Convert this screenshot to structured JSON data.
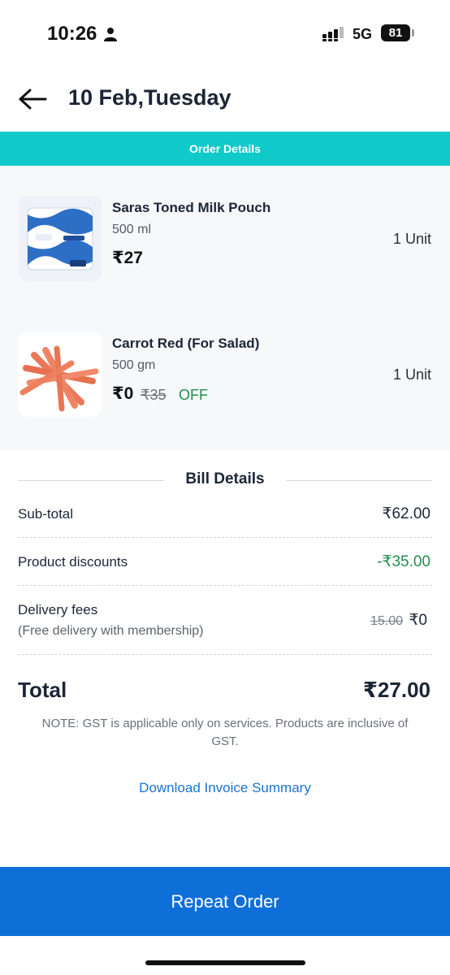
{
  "status_bar": {
    "time": "10:26",
    "network": "5G",
    "battery": "81"
  },
  "header": {
    "title": "10 Feb,Tuesday"
  },
  "band": {
    "label": "Order Details"
  },
  "items": [
    {
      "name": "Saras Toned Milk Pouch",
      "size": "500 ml",
      "price": "₹27",
      "quantity": "1 Unit"
    },
    {
      "name": "Carrot Red (For Salad)",
      "size": "500 gm",
      "price": "₹0",
      "mrp": "₹35",
      "discount_label": "OFF",
      "quantity": "1 Unit"
    }
  ],
  "bill": {
    "heading": "Bill Details",
    "subtotal_label": "Sub-total",
    "subtotal_value": "₹62.00",
    "discount_label": "Product discounts",
    "discount_value": "-₹35.00",
    "delivery_label": "Delivery fees",
    "delivery_note": "(Free delivery with membership)",
    "delivery_original": "15.00",
    "delivery_value": "₹0",
    "total_label": "Total",
    "total_value": "₹27.00",
    "note": "NOTE: GST is applicable only on services. Products are inclusive of GST.",
    "download_label": "Download Invoice Summary"
  },
  "footer": {
    "repeat_label": "Repeat Order"
  },
  "colors": {
    "band": "#0fcac9",
    "primary_button": "#0e6fd8",
    "discount_green": "#1f8f4f",
    "link": "#1a73d0"
  }
}
